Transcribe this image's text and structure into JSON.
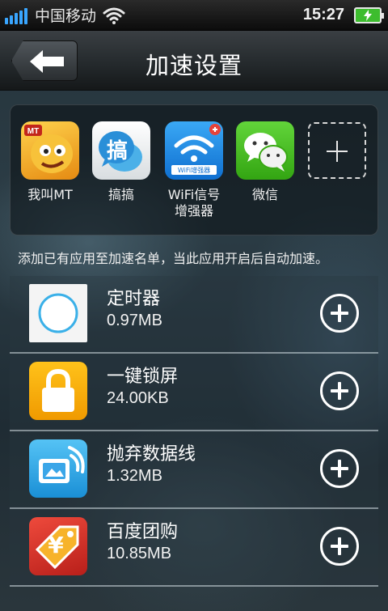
{
  "status_bar": {
    "carrier": "中国移动",
    "time": "15:27",
    "signal_icon": "signal-bars-icon",
    "wifi_icon": "wifi-icon",
    "battery_icon": "battery-charging-icon"
  },
  "header": {
    "title": "加速设置",
    "back_icon": "back-arrow-icon"
  },
  "accelerated_apps": [
    {
      "label": "我叫MT",
      "icon": "mt-game-icon"
    },
    {
      "label": "搞搞",
      "icon": "gaogao-chat-icon",
      "glyph": "搞"
    },
    {
      "label": "WiFi信号\n增强器",
      "icon": "wifi-booster-icon",
      "badge": "WiFi增强器"
    },
    {
      "label": "微信",
      "icon": "wechat-icon"
    }
  ],
  "add_slot_icon": "plus-icon",
  "hint": "添加已有应用至加速名单，当此应用开启后自动加速。",
  "apps": [
    {
      "name": "定时器",
      "size": "0.97MB",
      "icon": "timer-app-icon"
    },
    {
      "name": "一键锁屏",
      "size": "24.00KB",
      "icon": "lock-screen-app-icon"
    },
    {
      "name": "抛弃数据线",
      "size": "1.32MB",
      "icon": "wireless-transfer-app-icon"
    },
    {
      "name": "百度团购",
      "size": "10.85MB",
      "icon": "baidu-groupbuy-app-icon",
      "glyph": "¥"
    }
  ],
  "colors": {
    "accent_blue": "#39a6ff",
    "battery_green": "#3dbd2e",
    "wechat_green": "#4cc21f",
    "lock_orange": "#f5a800",
    "groupbuy_red": "#d9322b"
  }
}
